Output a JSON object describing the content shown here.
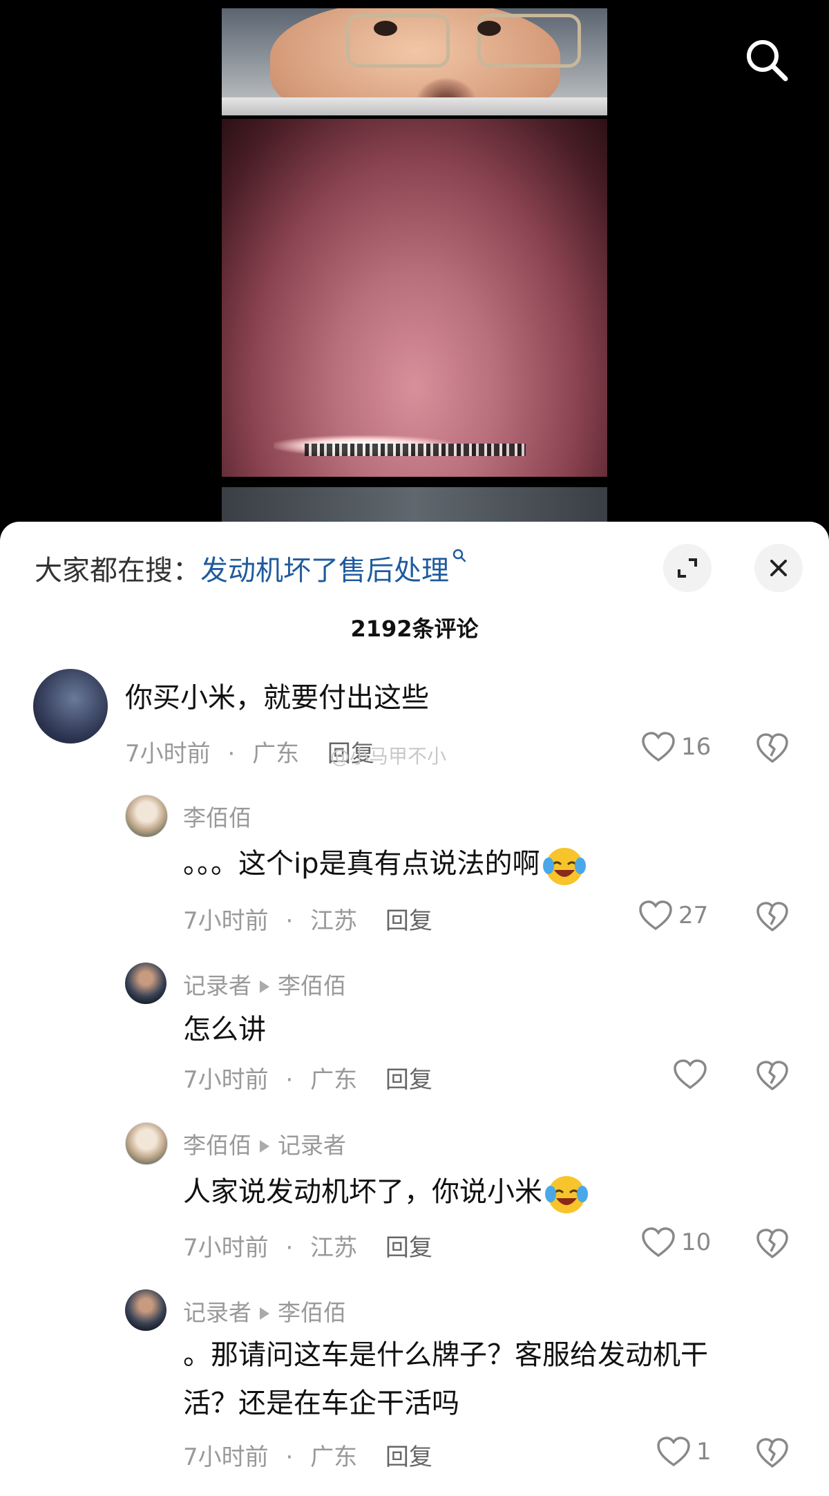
{
  "search": {
    "prefix": "大家都在搜：",
    "keyword": "发动机坏了售后处理"
  },
  "comment_count": "2192条评论",
  "watermark": "@小马甲不小",
  "comments": [
    {
      "text": "你买小米，就要付出这些",
      "time": "7小时前",
      "location": "广东",
      "reply_label": "回复",
      "likes": "16"
    },
    {
      "user": "李佰佰",
      "text": "。。。这个ip是真有点说法的啊",
      "time": "7小时前",
      "location": "江苏",
      "reply_label": "回复",
      "likes": "27"
    },
    {
      "user": "记录者",
      "reply_to": "李佰佰",
      "text": "怎么讲",
      "time": "7小时前",
      "location": "广东",
      "reply_label": "回复",
      "likes": ""
    },
    {
      "user": "李佰佰",
      "reply_to": "记录者",
      "text": "人家说发动机坏了，你说小米",
      "time": "7小时前",
      "location": "江苏",
      "reply_label": "回复",
      "likes": "10"
    },
    {
      "user": "记录者",
      "reply_to": "李佰佰",
      "text_line1": "。那请问这车是什么牌子？客服给发动机干",
      "text_line2": "活？还是在车企干活吗",
      "time": "7小时前",
      "location": "广东",
      "reply_label": "回复",
      "likes": "1"
    }
  ],
  "separator": "·",
  "icons": {
    "search": "search-icon",
    "expand": "expand-icon",
    "close": "close-icon",
    "like": "heart-icon",
    "dislike": "broken-heart-icon",
    "emoji": "laughing-crying-emoji-icon"
  },
  "colors": {
    "keyword": "#1f5b9e",
    "meta": "#999999",
    "text": "#111111"
  }
}
